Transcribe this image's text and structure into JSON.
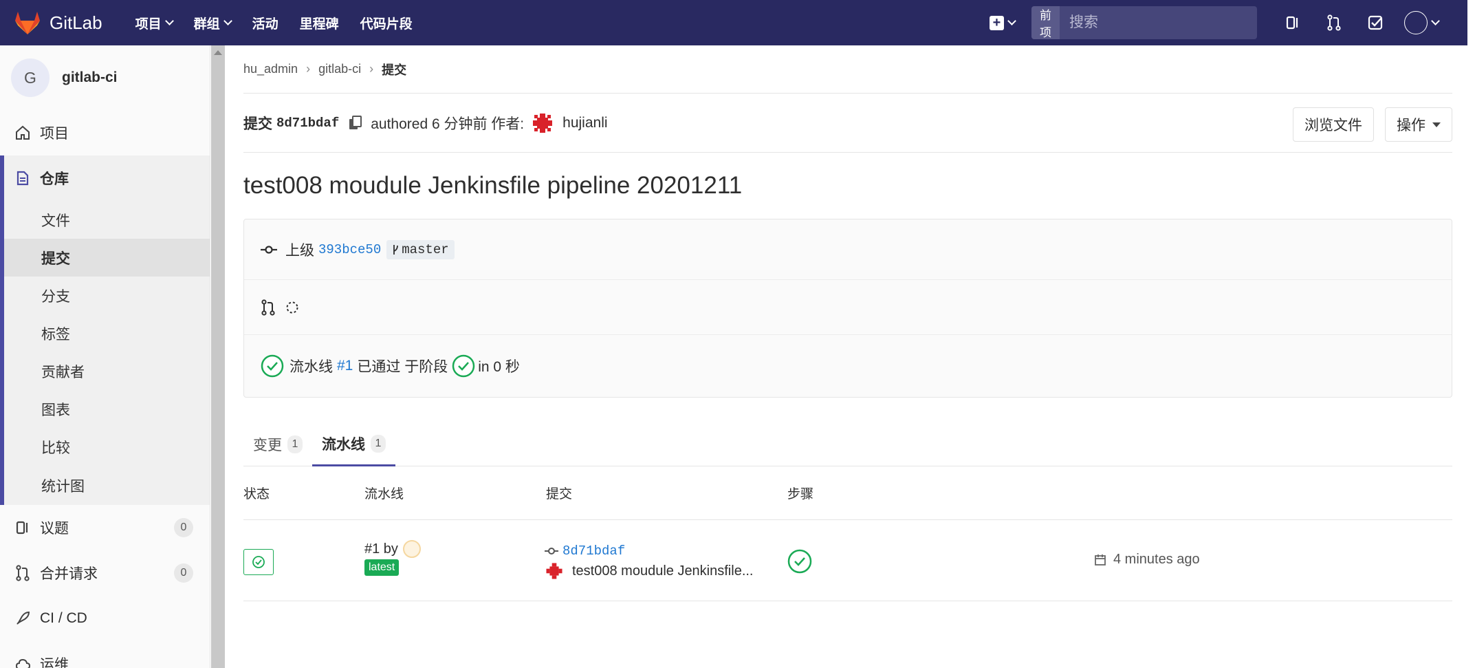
{
  "navbar": {
    "brand": "GitLab",
    "links": [
      {
        "label": "项目",
        "dropdown": true
      },
      {
        "label": "群组",
        "dropdown": true
      },
      {
        "label": "活动",
        "dropdown": false
      },
      {
        "label": "里程碑",
        "dropdown": false
      },
      {
        "label": "代码片段",
        "dropdown": false
      }
    ],
    "search_scope": "当前项目",
    "search_placeholder": "搜索"
  },
  "sidebar": {
    "project_initial": "G",
    "project_name": "gitlab-ci",
    "items": {
      "project": "项目",
      "repository": "仓库",
      "issues": "议题",
      "issues_count": "0",
      "merge_requests": "合并请求",
      "merge_requests_count": "0",
      "cicd": "CI / CD",
      "operations": "运维"
    },
    "repo_sub": [
      "文件",
      "提交",
      "分支",
      "标签",
      "贡献者",
      "图表",
      "比较",
      "统计图"
    ],
    "active_sub": "提交"
  },
  "breadcrumb": [
    "hu_admin",
    "gitlab-ci",
    "提交"
  ],
  "commit": {
    "label": "提交",
    "sha": "8d71bdaf",
    "authored": "authored 6 分钟前 作者:",
    "author": "hujianli",
    "browse_files": "浏览文件",
    "actions": "操作",
    "title": "test008 moudule Jenkinsfile pipeline 20201211",
    "parent_label": "上级",
    "parent_sha": "393bce50",
    "branch": "master",
    "pipeline_text_prefix": "流水线",
    "pipeline_id": "#1",
    "pipeline_text_mid": "已通过 于阶段",
    "pipeline_text_suffix": "in 0 秒"
  },
  "tabs": [
    {
      "label": "变更",
      "count": "1",
      "active": false
    },
    {
      "label": "流水线",
      "count": "1",
      "active": true
    }
  ],
  "pipelines_table": {
    "headers": [
      "状态",
      "流水线",
      "提交",
      "步骤"
    ],
    "rows": [
      {
        "pipeline_id": "#1 by",
        "badge": "latest",
        "commit_sha": "8d71bdaf",
        "commit_title": "test008 moudule Jenkinsfile...",
        "time": "4 minutes ago"
      }
    ]
  },
  "colors": {
    "navbar": "#292961",
    "accent": "#4b4ba3",
    "success": "#1aaa55",
    "link": "#1f78d1"
  }
}
